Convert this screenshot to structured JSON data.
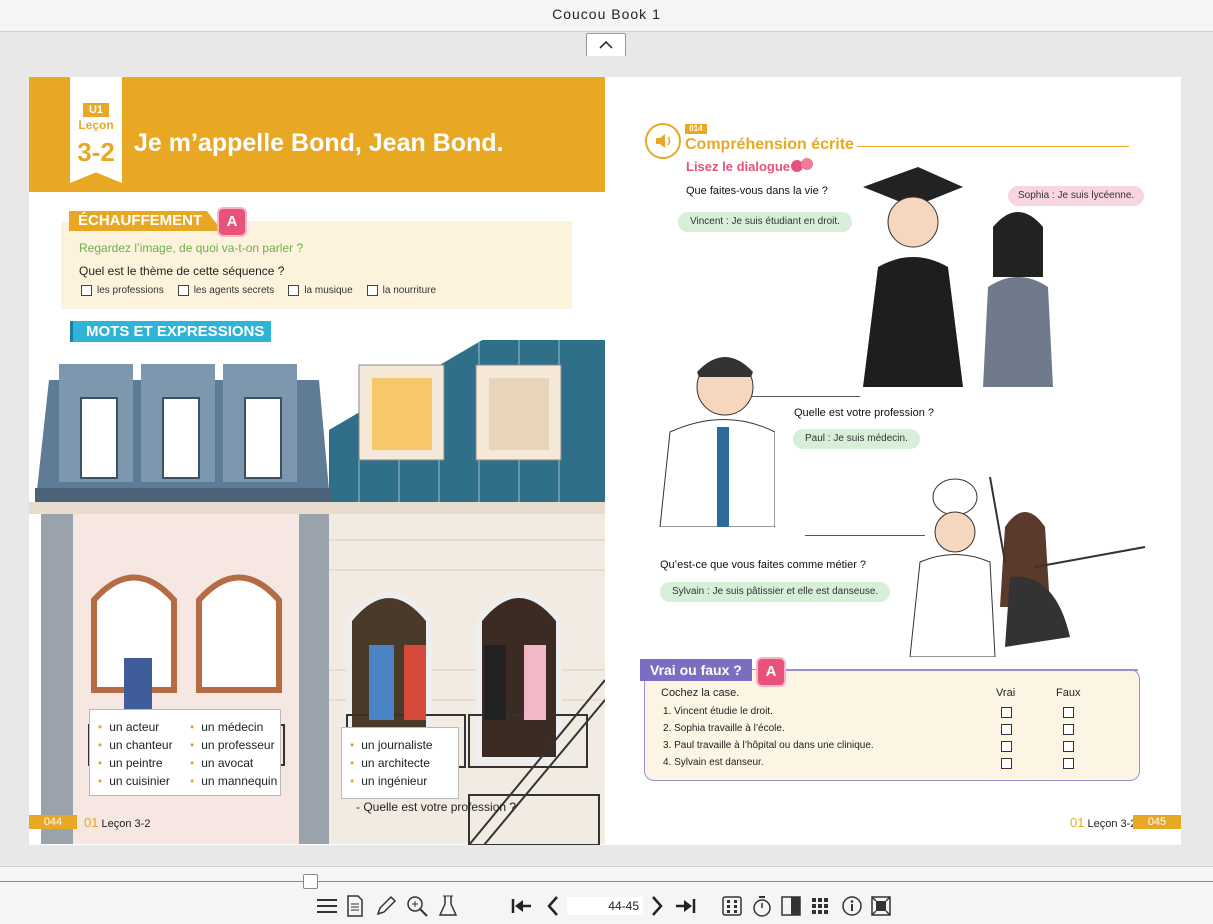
{
  "window": {
    "title": "Coucou Book 1"
  },
  "left_page": {
    "unit_label": "U1",
    "lecon_label": "Leçon",
    "lesson_number": "3-2",
    "title": "Je m’appelle Bond, Jean Bond.",
    "warmup": {
      "tag": "ÉCHAUFFEMENT",
      "badge": "A",
      "question1": "Regardez l’image, de quoi va-t-on parler ?",
      "question2": "Quel est le thème de cette séquence ?",
      "options": [
        "les professions",
        "les agents secrets",
        "la musique",
        "la nourriture"
      ]
    },
    "mots_tag": "MOTS ET EXPRESSIONS",
    "vocab_col1": [
      "un acteur",
      "un chanteur",
      "un peintre",
      "un cuisinier"
    ],
    "vocab_col2": [
      "un médecin",
      "un professeur",
      "un avocat",
      "un mannequin"
    ],
    "vocab_col3": [
      "un journaliste",
      "un architecte",
      "un ingénieur"
    ],
    "profession_question": "- Quelle est votre profession ?",
    "page_number": "044",
    "footer_unit": "01",
    "footer_lesson": "Leçon 3-2"
  },
  "right_page": {
    "track": "014",
    "title": "Compréhension écrite",
    "subtitle": "Lisez le dialogue",
    "dialogues": [
      {
        "question": "Que faites-vous dans la vie ?",
        "answer": "Vincent : Je suis étudiant en droit."
      },
      {
        "question": "",
        "answer": "Sophia : Je suis lycéenne."
      },
      {
        "question": "Quelle est votre profession ?",
        "answer": "Paul : Je suis médecin."
      },
      {
        "question": "Qu’est-ce que vous faites comme métier ?",
        "answer": "Sylvain : Je suis pâtissier et elle est danseuse."
      }
    ],
    "vrai_ou_faux": {
      "tag": "Vrai ou faux ?",
      "badge": "A",
      "instruction": "Cochez la case.",
      "col_vrai": "Vrai",
      "col_faux": "Faux",
      "items": [
        "1. Vincent étudie le droit.",
        "2. Sophia travaille à l’école.",
        "3. Paul travaille à l’hôpital ou dans une clinique.",
        "4. Sylvain est danseur."
      ]
    },
    "footer_unit": "01",
    "footer_lesson": "Leçon 3-2",
    "page_number": "045"
  },
  "toolbar": {
    "page_field": "44-45",
    "icons": [
      "menu-icon",
      "document-icon",
      "pencil-icon",
      "zoom-in-icon",
      "flask-icon",
      "first-page-icon",
      "prev-page-icon",
      "next-page-icon",
      "last-page-icon",
      "dual-page-icon",
      "timer-icon",
      "single-page-icon",
      "grid-icon",
      "info-icon",
      "fullscreen-icon"
    ]
  },
  "colors": {
    "accent_orange": "#e8a824",
    "accent_blue": "#2fb3d6",
    "accent_pink": "#e8527a",
    "accent_purple": "#7b6ec0"
  }
}
